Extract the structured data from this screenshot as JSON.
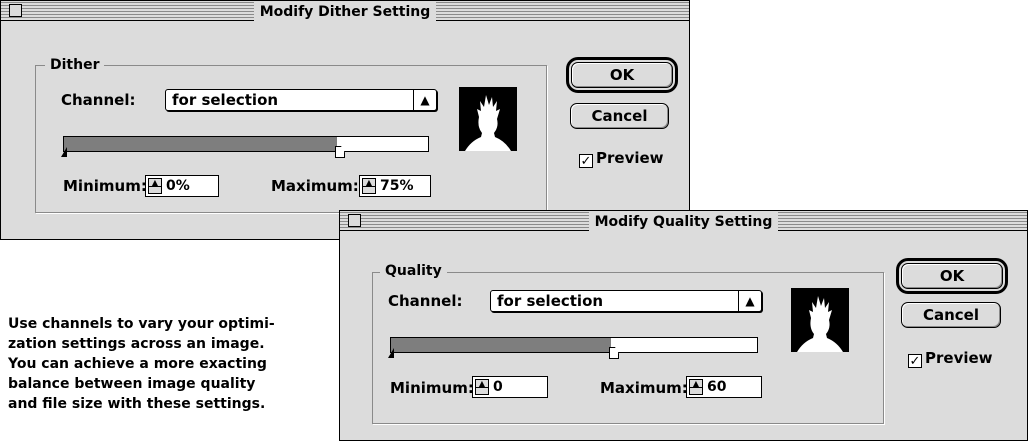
{
  "dither_dialog": {
    "title": "Modify Dither Setting",
    "group_label": "Dither",
    "channel_label": "Channel:",
    "channel_value": "for selection",
    "minimum_label": "Minimum:",
    "minimum_value": "0%",
    "maximum_label": "Maximum:",
    "maximum_value": "75%",
    "slider_max_fraction": 0.75,
    "ok_label": "OK",
    "cancel_label": "Cancel",
    "preview_label": "Preview",
    "preview_checked": true
  },
  "quality_dialog": {
    "title": "Modify Quality Setting",
    "group_label": "Quality",
    "channel_label": "Channel:",
    "channel_value": "for selection",
    "minimum_label": "Minimum:",
    "minimum_value": "0",
    "maximum_label": "Maximum:",
    "maximum_value": "60",
    "slider_max_fraction": 0.6,
    "ok_label": "OK",
    "cancel_label": "Cancel",
    "preview_label": "Preview",
    "preview_checked": true
  },
  "caption": {
    "lines": [
      "Use channels to vary your optimi-",
      "zation settings across an image.",
      "You can achieve a more exacting",
      "balance between image quality",
      "and file size with these settings."
    ]
  },
  "icons": {
    "popup_arrows": "updown-arrows-icon",
    "check": "checkmark-icon"
  }
}
